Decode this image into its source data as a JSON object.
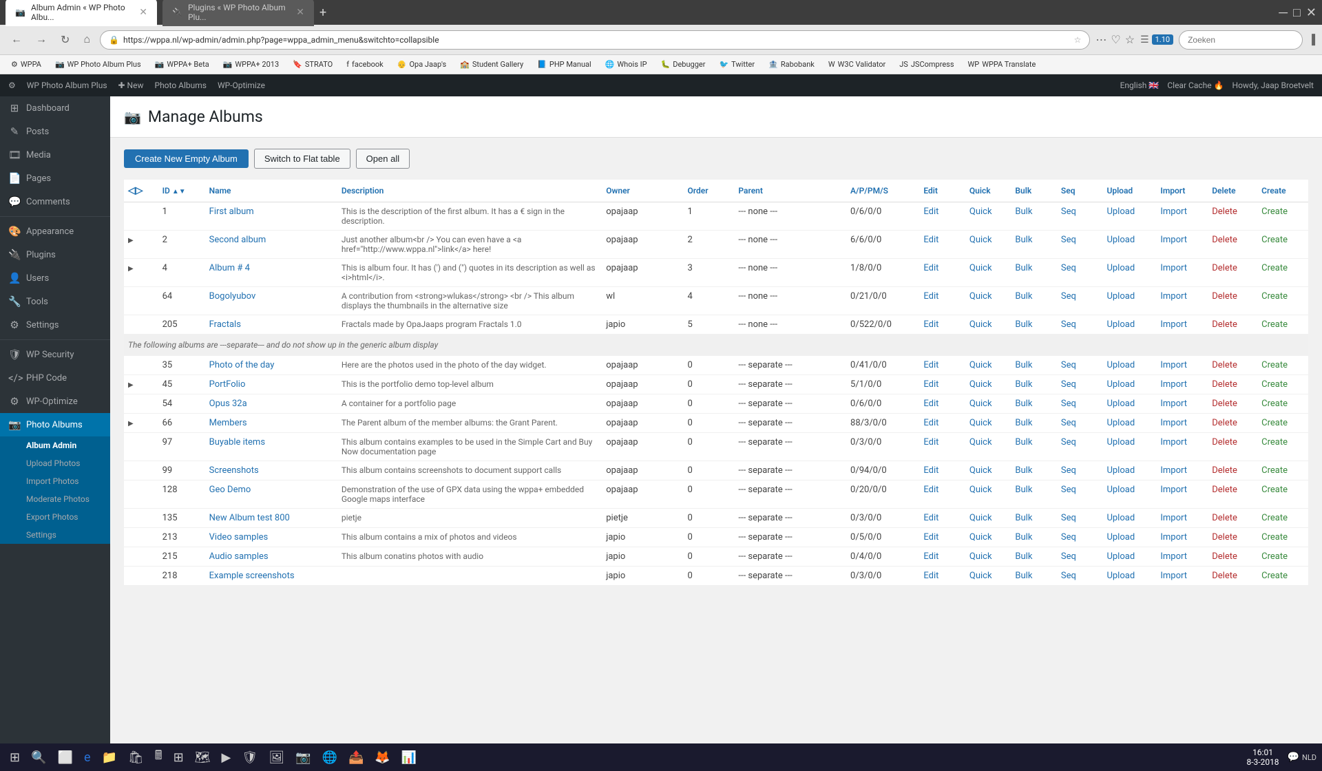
{
  "browser": {
    "tabs": [
      {
        "id": "tab1",
        "label": "Album Admin « WP Photo Albu...",
        "active": true
      },
      {
        "id": "tab2",
        "label": "Plugins « WP Photo Album Plu...",
        "active": false
      }
    ],
    "address": "https://wppa.nl/wp-admin/admin.php?page=wppa_admin_menu&switchto=collapsible",
    "search_placeholder": "Zoeken",
    "bookmarks": [
      {
        "label": "WPPA"
      },
      {
        "label": "WP Photo Album Plus"
      },
      {
        "label": "WPPA+ Beta"
      },
      {
        "label": "WPPA+ 2013"
      },
      {
        "label": "STRATO"
      },
      {
        "label": "facebook"
      },
      {
        "label": "Opa Jaap's"
      },
      {
        "label": "Student Gallery"
      },
      {
        "label": "PHP Manual"
      },
      {
        "label": "Whois IP"
      },
      {
        "label": "Debugger"
      },
      {
        "label": "Twitter"
      },
      {
        "label": "Rabobank"
      },
      {
        "label": "W3C Validator"
      },
      {
        "label": "JSCompress"
      },
      {
        "label": "WPPA Translate"
      }
    ]
  },
  "adminbar": {
    "items": [
      {
        "label": "⚙ WPPA"
      },
      {
        "label": "WP Photo Album Plus"
      },
      {
        "label": "✚ New"
      },
      {
        "label": "Photo Albums"
      },
      {
        "label": "WP-Optimize"
      }
    ],
    "right_items": [
      {
        "label": "English 🇬🇧"
      },
      {
        "label": "Clear Cache 🔥"
      },
      {
        "label": "Howdy, Jaap Broetvelt"
      }
    ]
  },
  "sidebar": {
    "items": [
      {
        "id": "dashboard",
        "icon": "⊞",
        "label": "Dashboard"
      },
      {
        "id": "posts",
        "icon": "✎",
        "label": "Posts"
      },
      {
        "id": "media",
        "icon": "🎞",
        "label": "Media"
      },
      {
        "id": "pages",
        "icon": "📄",
        "label": "Pages"
      },
      {
        "id": "comments",
        "icon": "💬",
        "label": "Comments"
      },
      {
        "id": "appearance",
        "icon": "🎨",
        "label": "Appearance"
      },
      {
        "id": "plugins",
        "icon": "🔌",
        "label": "Plugins"
      },
      {
        "id": "users",
        "icon": "👤",
        "label": "Users"
      },
      {
        "id": "tools",
        "icon": "🔧",
        "label": "Tools"
      },
      {
        "id": "settings",
        "icon": "⚙",
        "label": "Settings"
      },
      {
        "id": "wpsecurity",
        "icon": "🛡",
        "label": "WP Security"
      },
      {
        "id": "phpcode",
        "icon": "⟨⟩",
        "label": "PHP Code"
      },
      {
        "id": "wpoptimize",
        "icon": "⚙",
        "label": "WP-Optimize"
      },
      {
        "id": "photoalbums",
        "icon": "📷",
        "label": "Photo Albums"
      }
    ],
    "photo_albums_submenu": [
      {
        "id": "album-admin",
        "label": "Album Admin",
        "active": true
      },
      {
        "id": "upload-photos",
        "label": "Upload Photos"
      },
      {
        "id": "import-photos",
        "label": "Import Photos"
      },
      {
        "id": "moderate-photos",
        "label": "Moderate Photos"
      },
      {
        "id": "export-photos",
        "label": "Export Photos"
      },
      {
        "id": "sub-settings",
        "label": "Settings"
      }
    ]
  },
  "page": {
    "title": "Manage Albums",
    "buttons": {
      "create": "Create New Empty Album",
      "flat": "Switch to Flat table",
      "open": "Open all"
    },
    "table": {
      "headers": [
        "",
        "ID",
        "Name",
        "Description",
        "Owner",
        "Order",
        "Parent",
        "A/P/PM/S",
        "Edit",
        "Quick",
        "Bulk",
        "Seq",
        "Upload",
        "Import",
        "Delete",
        "Create"
      ],
      "rows": [
        {
          "expand": false,
          "id": "1",
          "name": "First album",
          "desc": "This is the description of the first album. It has a € sign in the description.",
          "owner": "opajaap",
          "order": "1",
          "parent": "--- none ---",
          "apms": "0/6/0/0"
        },
        {
          "expand": true,
          "id": "2",
          "name": "Second album",
          "desc": "Just another album<br /> You can even have a <a href=\"http://www.wppa.nl\">link</a> here!",
          "owner": "opajaap",
          "order": "2",
          "parent": "--- none ---",
          "apms": "6/6/0/0"
        },
        {
          "expand": true,
          "id": "4",
          "name": "Album # 4",
          "desc": "This is album four. It has (') and (\") quotes in its description as well as <i>html</i>.",
          "owner": "opajaap",
          "order": "3",
          "parent": "--- none ---",
          "apms": "1/8/0/0"
        },
        {
          "expand": false,
          "id": "64",
          "name": "Bogolyubov",
          "desc": "A contribution from <strong>wlukas</strong> <br /> This album displays the thumbnails in the alternative size",
          "owner": "wl",
          "order": "4",
          "parent": "--- none ---",
          "apms": "0/21/0/0"
        },
        {
          "expand": false,
          "id": "205",
          "name": "Fractals",
          "desc": "Fractals made by OpaJaaps program Fractals 1.0",
          "owner": "japio",
          "order": "5",
          "parent": "--- none ---",
          "apms": "0/522/0/0"
        }
      ],
      "separator": "The following albums are ---separate--- and do not show up in the generic album display",
      "separate_rows": [
        {
          "expand": false,
          "id": "35",
          "name": "Photo of the day",
          "desc": "Here are the photos used in the photo of the day widget.",
          "owner": "opajaap",
          "order": "0",
          "parent": "--- separate ---",
          "apms": "0/41/0/0"
        },
        {
          "expand": true,
          "id": "45",
          "name": "PortFolio",
          "desc": "This is the portfolio demo top-level album",
          "owner": "opajaap",
          "order": "0",
          "parent": "--- separate ---",
          "apms": "5/1/0/0"
        },
        {
          "expand": false,
          "id": "54",
          "name": "Opus 32a",
          "desc": "A container for a portfolio page",
          "owner": "opajaap",
          "order": "0",
          "parent": "--- separate ---",
          "apms": "0/6/0/0"
        },
        {
          "expand": true,
          "id": "66",
          "name": "Members",
          "desc": "The Parent album of the member albums: the Grant Parent.",
          "owner": "opajaap",
          "order": "0",
          "parent": "--- separate ---",
          "apms": "88/3/0/0"
        },
        {
          "expand": false,
          "id": "97",
          "name": "Buyable items",
          "desc": "This album contains examples to be used in the Simple Cart and Buy Now documentation page",
          "owner": "opajaap",
          "order": "0",
          "parent": "--- separate ---",
          "apms": "0/3/0/0"
        },
        {
          "expand": false,
          "id": "99",
          "name": "Screenshots",
          "desc": "This album contains screenshots to document support calls",
          "owner": "opajaap",
          "order": "0",
          "parent": "--- separate ---",
          "apms": "0/94/0/0"
        },
        {
          "expand": false,
          "id": "128",
          "name": "Geo Demo",
          "desc": "Demonstration of the use of GPX data using the wppa+ embedded Google maps interface",
          "owner": "opajaap",
          "order": "0",
          "parent": "--- separate ---",
          "apms": "0/20/0/0"
        },
        {
          "expand": false,
          "id": "135",
          "name": "New Album test 800",
          "desc": "pietje",
          "owner": "pietje",
          "order": "0",
          "parent": "--- separate ---",
          "apms": "0/3/0/0"
        },
        {
          "expand": false,
          "id": "213",
          "name": "Video samples",
          "desc": "This album contains a mix of photos and videos",
          "owner": "japio",
          "order": "0",
          "parent": "--- separate ---",
          "apms": "0/5/0/0"
        },
        {
          "expand": false,
          "id": "215",
          "name": "Audio samples",
          "desc": "This album conatins photos with audio",
          "owner": "japio",
          "order": "0",
          "parent": "--- separate ---",
          "apms": "0/4/0/0"
        },
        {
          "expand": false,
          "id": "218",
          "name": "Example screenshots",
          "desc": "",
          "owner": "japio",
          "order": "0",
          "parent": "--- separate ---",
          "apms": "0/3/0/0"
        }
      ],
      "action_links": [
        "Edit",
        "Quick",
        "Bulk",
        "Seq",
        "Upload",
        "Import",
        "Delete",
        "Create"
      ]
    }
  },
  "taskbar": {
    "time": "16:01",
    "date": "8-3-2018",
    "language": "NLD"
  }
}
